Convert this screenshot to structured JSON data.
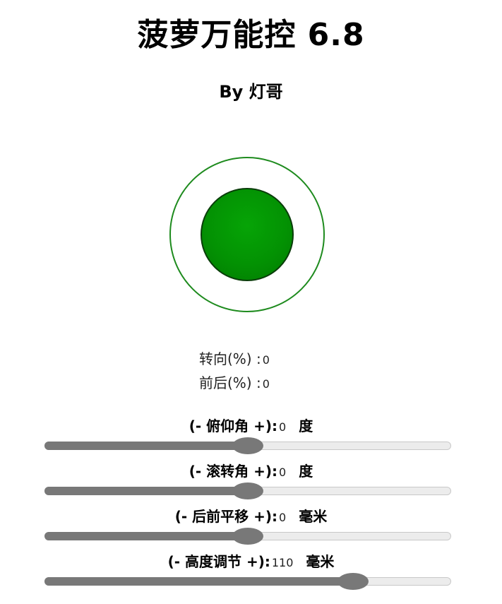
{
  "header": {
    "title": "菠萝万能控 6.8",
    "subtitle": "By 灯哥"
  },
  "colors": {
    "joystick_ring": "#1e8b1e",
    "joystick_knob": "#039203",
    "slider_fill": "#787878",
    "slider_track": "#ececec"
  },
  "readouts": {
    "steer_label": "转向(%) :",
    "steer_value": "0",
    "fb_label": "前后(%) :",
    "fb_value": "0"
  },
  "sliders": [
    {
      "prefix": "(- 俯仰角 +):",
      "value": "0",
      "unit": "度",
      "level": 0.5
    },
    {
      "prefix": "(- 滚转角 +):",
      "value": "0",
      "unit": "度",
      "level": 0.5
    },
    {
      "prefix": "(- 后前平移 +):",
      "value": "0",
      "unit": "毫米",
      "level": 0.5
    },
    {
      "prefix": "(- 高度调节 +):",
      "value": "110",
      "unit": "毫米",
      "level": 0.78
    }
  ]
}
